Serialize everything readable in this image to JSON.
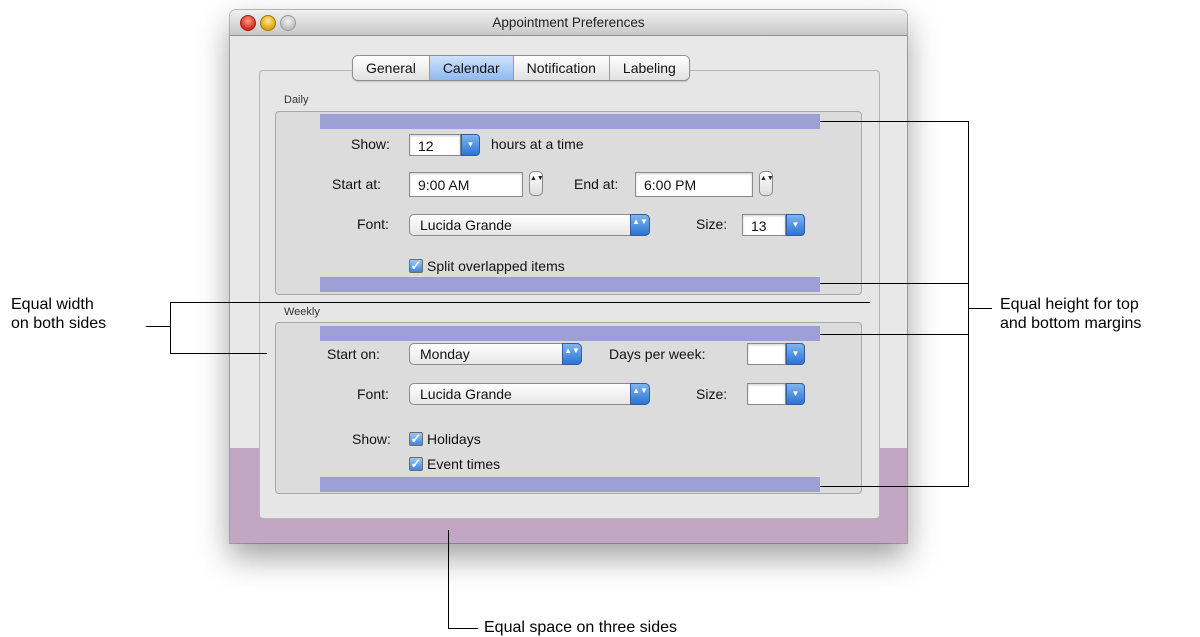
{
  "window": {
    "title": "Appointment Preferences"
  },
  "tabs": [
    {
      "label": "General",
      "selected": false
    },
    {
      "label": "Calendar",
      "selected": true
    },
    {
      "label": "Notification",
      "selected": false
    },
    {
      "label": "Labeling",
      "selected": false
    }
  ],
  "daily": {
    "group_label": "Daily",
    "show_label": "Show:",
    "show_value": "12",
    "show_suffix": "hours at a time",
    "start_label": "Start at:",
    "start_value": "9:00 AM",
    "end_label": "End at:",
    "end_value": "6:00 PM",
    "font_label": "Font:",
    "font_value": "Lucida Grande",
    "size_label": "Size:",
    "size_value": "13",
    "split_label": "Split overlapped items",
    "split_checked": true
  },
  "weekly": {
    "group_label": "Weekly",
    "start_label": "Start on:",
    "start_value": "Monday",
    "days_label": "Days per week:",
    "days_value": "",
    "font_label": "Font:",
    "font_value": "Lucida Grande",
    "size_label": "Size:",
    "size_value": "",
    "show_label": "Show:",
    "holidays_label": "Holidays",
    "holidays_checked": true,
    "event_times_label": "Event times",
    "event_times_checked": true
  },
  "annotations": {
    "left_line1": "Equal width",
    "left_line2": "on both sides",
    "right_line1": "Equal height for top",
    "right_line2": "and bottom margins",
    "bottom": "Equal space on three sides"
  },
  "colors": {
    "margin_marker": "#9d9fd7",
    "side_band": "#86c0bd",
    "bottom_band": "#c3a6c3",
    "selected_tab": "#8fb9ef"
  },
  "icons": {
    "check": "✓",
    "popup_arrows": "▲▼",
    "combo_arrow": "▼"
  }
}
